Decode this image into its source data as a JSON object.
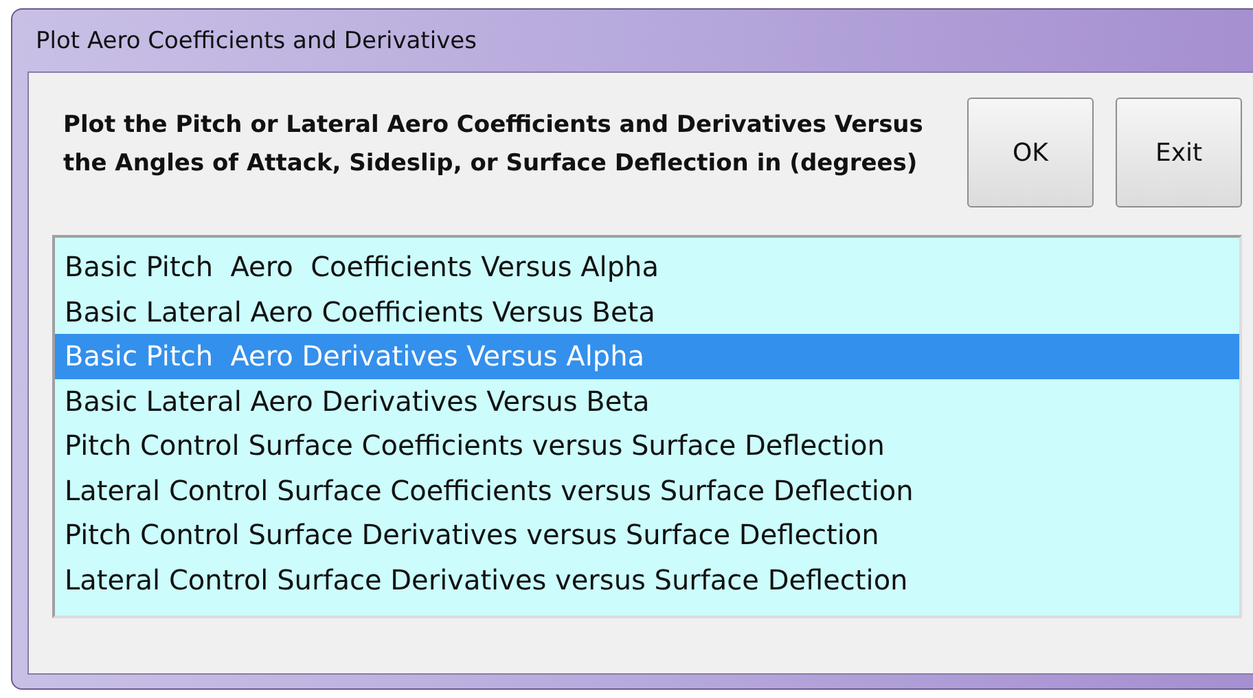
{
  "window": {
    "title": "Plot Aero Coefficients and Derivatives"
  },
  "instructions": "Plot the Pitch or Lateral Aero Coefficients and Derivatives Versus the Angles of Attack, Sideslip, or Surface Deflection in (degrees)",
  "buttons": [
    {
      "label": "OK"
    },
    {
      "label": "Exit"
    }
  ],
  "list": {
    "items": [
      {
        "label": "Basic Pitch  Aero  Coefficients Versus Alpha",
        "selected": false
      },
      {
        "label": "Basic Lateral Aero Coefficients Versus Beta",
        "selected": false
      },
      {
        "label": "Basic Pitch  Aero Derivatives Versus Alpha",
        "selected": true
      },
      {
        "label": "Basic Lateral Aero Derivatives Versus Beta",
        "selected": false
      },
      {
        "label": "Pitch Control Surface Coefficients versus Surface Deflection",
        "selected": false
      },
      {
        "label": "Lateral Control Surface Coefficients versus Surface Deflection",
        "selected": false
      },
      {
        "label": "Pitch Control Surface Derivatives versus Surface Deflection",
        "selected": false
      },
      {
        "label": "Lateral Control Surface Derivatives versus Surface Deflection",
        "selected": false
      }
    ]
  }
}
